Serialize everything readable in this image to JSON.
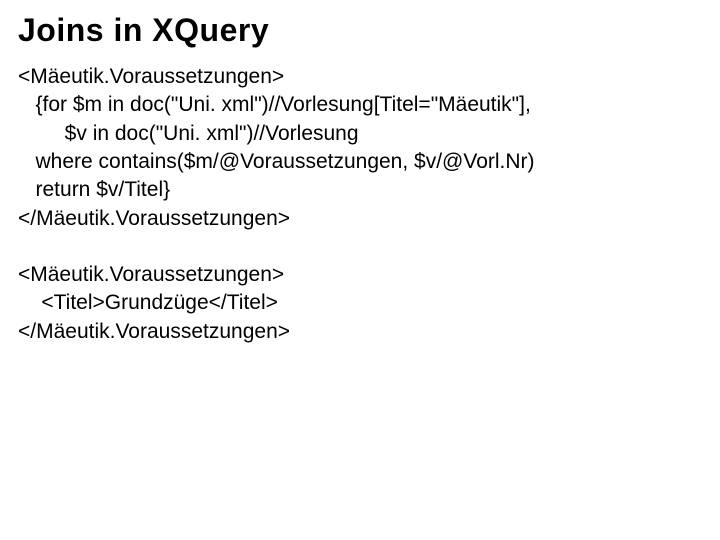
{
  "title": "Joins in XQuery",
  "code1": {
    "l1": "<Mäeutik.Voraussetzungen>",
    "l2": "   {for $m in doc(\"Uni. xml\")//Vorlesung[Titel=\"Mäeutik\"],",
    "l3": "        $v in doc(\"Uni. xml\")//Vorlesung",
    "l4": "   where contains($m/@Voraussetzungen, $v/@Vorl.Nr)",
    "l5": "   return $v/Titel}",
    "l6": "</Mäeutik.Voraussetzungen>"
  },
  "code2": {
    "l1": "<Mäeutik.Voraussetzungen>",
    "l2": "    <Titel>Grundzüge</Titel>",
    "l3": "</Mäeutik.Voraussetzungen>"
  }
}
